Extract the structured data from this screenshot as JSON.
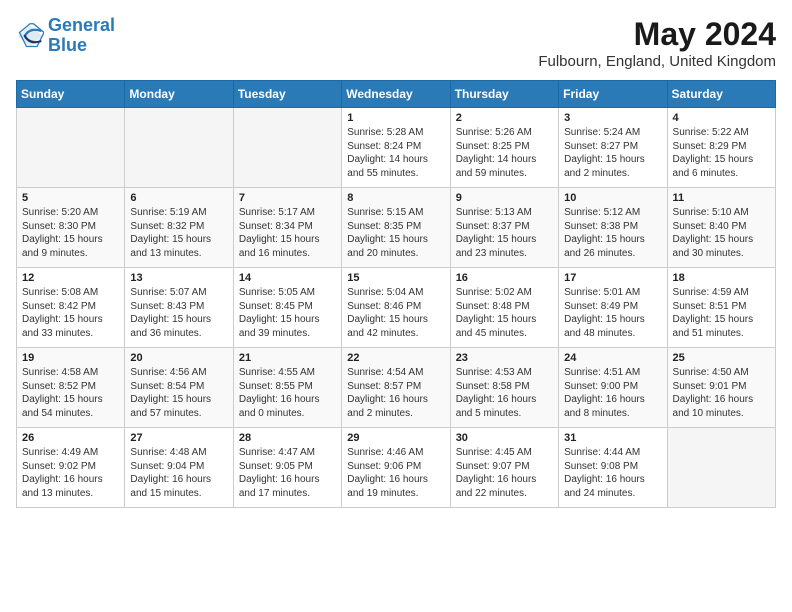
{
  "header": {
    "logo_line1": "General",
    "logo_line2": "Blue",
    "month_title": "May 2024",
    "location": "Fulbourn, England, United Kingdom"
  },
  "days_of_week": [
    "Sunday",
    "Monday",
    "Tuesday",
    "Wednesday",
    "Thursday",
    "Friday",
    "Saturday"
  ],
  "weeks": [
    [
      {
        "day": "",
        "info": ""
      },
      {
        "day": "",
        "info": ""
      },
      {
        "day": "",
        "info": ""
      },
      {
        "day": "1",
        "info": "Sunrise: 5:28 AM\nSunset: 8:24 PM\nDaylight: 14 hours\nand 55 minutes."
      },
      {
        "day": "2",
        "info": "Sunrise: 5:26 AM\nSunset: 8:25 PM\nDaylight: 14 hours\nand 59 minutes."
      },
      {
        "day": "3",
        "info": "Sunrise: 5:24 AM\nSunset: 8:27 PM\nDaylight: 15 hours\nand 2 minutes."
      },
      {
        "day": "4",
        "info": "Sunrise: 5:22 AM\nSunset: 8:29 PM\nDaylight: 15 hours\nand 6 minutes."
      }
    ],
    [
      {
        "day": "5",
        "info": "Sunrise: 5:20 AM\nSunset: 8:30 PM\nDaylight: 15 hours\nand 9 minutes."
      },
      {
        "day": "6",
        "info": "Sunrise: 5:19 AM\nSunset: 8:32 PM\nDaylight: 15 hours\nand 13 minutes."
      },
      {
        "day": "7",
        "info": "Sunrise: 5:17 AM\nSunset: 8:34 PM\nDaylight: 15 hours\nand 16 minutes."
      },
      {
        "day": "8",
        "info": "Sunrise: 5:15 AM\nSunset: 8:35 PM\nDaylight: 15 hours\nand 20 minutes."
      },
      {
        "day": "9",
        "info": "Sunrise: 5:13 AM\nSunset: 8:37 PM\nDaylight: 15 hours\nand 23 minutes."
      },
      {
        "day": "10",
        "info": "Sunrise: 5:12 AM\nSunset: 8:38 PM\nDaylight: 15 hours\nand 26 minutes."
      },
      {
        "day": "11",
        "info": "Sunrise: 5:10 AM\nSunset: 8:40 PM\nDaylight: 15 hours\nand 30 minutes."
      }
    ],
    [
      {
        "day": "12",
        "info": "Sunrise: 5:08 AM\nSunset: 8:42 PM\nDaylight: 15 hours\nand 33 minutes."
      },
      {
        "day": "13",
        "info": "Sunrise: 5:07 AM\nSunset: 8:43 PM\nDaylight: 15 hours\nand 36 minutes."
      },
      {
        "day": "14",
        "info": "Sunrise: 5:05 AM\nSunset: 8:45 PM\nDaylight: 15 hours\nand 39 minutes."
      },
      {
        "day": "15",
        "info": "Sunrise: 5:04 AM\nSunset: 8:46 PM\nDaylight: 15 hours\nand 42 minutes."
      },
      {
        "day": "16",
        "info": "Sunrise: 5:02 AM\nSunset: 8:48 PM\nDaylight: 15 hours\nand 45 minutes."
      },
      {
        "day": "17",
        "info": "Sunrise: 5:01 AM\nSunset: 8:49 PM\nDaylight: 15 hours\nand 48 minutes."
      },
      {
        "day": "18",
        "info": "Sunrise: 4:59 AM\nSunset: 8:51 PM\nDaylight: 15 hours\nand 51 minutes."
      }
    ],
    [
      {
        "day": "19",
        "info": "Sunrise: 4:58 AM\nSunset: 8:52 PM\nDaylight: 15 hours\nand 54 minutes."
      },
      {
        "day": "20",
        "info": "Sunrise: 4:56 AM\nSunset: 8:54 PM\nDaylight: 15 hours\nand 57 minutes."
      },
      {
        "day": "21",
        "info": "Sunrise: 4:55 AM\nSunset: 8:55 PM\nDaylight: 16 hours\nand 0 minutes."
      },
      {
        "day": "22",
        "info": "Sunrise: 4:54 AM\nSunset: 8:57 PM\nDaylight: 16 hours\nand 2 minutes."
      },
      {
        "day": "23",
        "info": "Sunrise: 4:53 AM\nSunset: 8:58 PM\nDaylight: 16 hours\nand 5 minutes."
      },
      {
        "day": "24",
        "info": "Sunrise: 4:51 AM\nSunset: 9:00 PM\nDaylight: 16 hours\nand 8 minutes."
      },
      {
        "day": "25",
        "info": "Sunrise: 4:50 AM\nSunset: 9:01 PM\nDaylight: 16 hours\nand 10 minutes."
      }
    ],
    [
      {
        "day": "26",
        "info": "Sunrise: 4:49 AM\nSunset: 9:02 PM\nDaylight: 16 hours\nand 13 minutes."
      },
      {
        "day": "27",
        "info": "Sunrise: 4:48 AM\nSunset: 9:04 PM\nDaylight: 16 hours\nand 15 minutes."
      },
      {
        "day": "28",
        "info": "Sunrise: 4:47 AM\nSunset: 9:05 PM\nDaylight: 16 hours\nand 17 minutes."
      },
      {
        "day": "29",
        "info": "Sunrise: 4:46 AM\nSunset: 9:06 PM\nDaylight: 16 hours\nand 19 minutes."
      },
      {
        "day": "30",
        "info": "Sunrise: 4:45 AM\nSunset: 9:07 PM\nDaylight: 16 hours\nand 22 minutes."
      },
      {
        "day": "31",
        "info": "Sunrise: 4:44 AM\nSunset: 9:08 PM\nDaylight: 16 hours\nand 24 minutes."
      },
      {
        "day": "",
        "info": ""
      }
    ]
  ]
}
